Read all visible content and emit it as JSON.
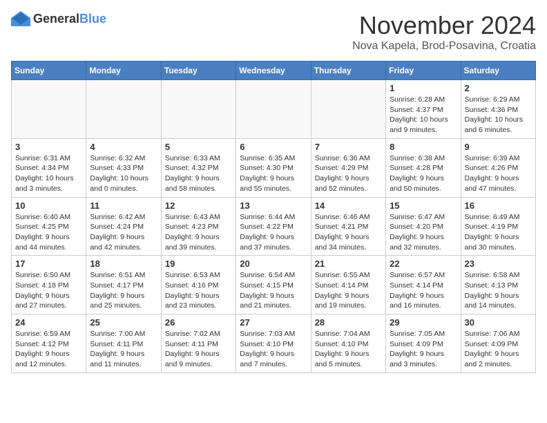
{
  "header": {
    "logo_general": "General",
    "logo_blue": "Blue",
    "month": "November 2024",
    "location": "Nova Kapela, Brod-Posavina, Croatia"
  },
  "days_of_week": [
    "Sunday",
    "Monday",
    "Tuesday",
    "Wednesday",
    "Thursday",
    "Friday",
    "Saturday"
  ],
  "weeks": [
    [
      {
        "day": "",
        "info": ""
      },
      {
        "day": "",
        "info": ""
      },
      {
        "day": "",
        "info": ""
      },
      {
        "day": "",
        "info": ""
      },
      {
        "day": "",
        "info": ""
      },
      {
        "day": "1",
        "info": "Sunrise: 6:28 AM\nSunset: 4:37 PM\nDaylight: 10 hours and 9 minutes."
      },
      {
        "day": "2",
        "info": "Sunrise: 6:29 AM\nSunset: 4:36 PM\nDaylight: 10 hours and 6 minutes."
      }
    ],
    [
      {
        "day": "3",
        "info": "Sunrise: 6:31 AM\nSunset: 4:34 PM\nDaylight: 10 hours and 3 minutes."
      },
      {
        "day": "4",
        "info": "Sunrise: 6:32 AM\nSunset: 4:33 PM\nDaylight: 10 hours and 0 minutes."
      },
      {
        "day": "5",
        "info": "Sunrise: 6:33 AM\nSunset: 4:32 PM\nDaylight: 9 hours and 58 minutes."
      },
      {
        "day": "6",
        "info": "Sunrise: 6:35 AM\nSunset: 4:30 PM\nDaylight: 9 hours and 55 minutes."
      },
      {
        "day": "7",
        "info": "Sunrise: 6:36 AM\nSunset: 4:29 PM\nDaylight: 9 hours and 52 minutes."
      },
      {
        "day": "8",
        "info": "Sunrise: 6:38 AM\nSunset: 4:28 PM\nDaylight: 9 hours and 50 minutes."
      },
      {
        "day": "9",
        "info": "Sunrise: 6:39 AM\nSunset: 4:26 PM\nDaylight: 9 hours and 47 minutes."
      }
    ],
    [
      {
        "day": "10",
        "info": "Sunrise: 6:40 AM\nSunset: 4:25 PM\nDaylight: 9 hours and 44 minutes."
      },
      {
        "day": "11",
        "info": "Sunrise: 6:42 AM\nSunset: 4:24 PM\nDaylight: 9 hours and 42 minutes."
      },
      {
        "day": "12",
        "info": "Sunrise: 6:43 AM\nSunset: 4:23 PM\nDaylight: 9 hours and 39 minutes."
      },
      {
        "day": "13",
        "info": "Sunrise: 6:44 AM\nSunset: 4:22 PM\nDaylight: 9 hours and 37 minutes."
      },
      {
        "day": "14",
        "info": "Sunrise: 6:46 AM\nSunset: 4:21 PM\nDaylight: 9 hours and 34 minutes."
      },
      {
        "day": "15",
        "info": "Sunrise: 6:47 AM\nSunset: 4:20 PM\nDaylight: 9 hours and 32 minutes."
      },
      {
        "day": "16",
        "info": "Sunrise: 6:49 AM\nSunset: 4:19 PM\nDaylight: 9 hours and 30 minutes."
      }
    ],
    [
      {
        "day": "17",
        "info": "Sunrise: 6:50 AM\nSunset: 4:18 PM\nDaylight: 9 hours and 27 minutes."
      },
      {
        "day": "18",
        "info": "Sunrise: 6:51 AM\nSunset: 4:17 PM\nDaylight: 9 hours and 25 minutes."
      },
      {
        "day": "19",
        "info": "Sunrise: 6:53 AM\nSunset: 4:16 PM\nDaylight: 9 hours and 23 minutes."
      },
      {
        "day": "20",
        "info": "Sunrise: 6:54 AM\nSunset: 4:15 PM\nDaylight: 9 hours and 21 minutes."
      },
      {
        "day": "21",
        "info": "Sunrise: 6:55 AM\nSunset: 4:14 PM\nDaylight: 9 hours and 19 minutes."
      },
      {
        "day": "22",
        "info": "Sunrise: 6:57 AM\nSunset: 4:14 PM\nDaylight: 9 hours and 16 minutes."
      },
      {
        "day": "23",
        "info": "Sunrise: 6:58 AM\nSunset: 4:13 PM\nDaylight: 9 hours and 14 minutes."
      }
    ],
    [
      {
        "day": "24",
        "info": "Sunrise: 6:59 AM\nSunset: 4:12 PM\nDaylight: 9 hours and 12 minutes."
      },
      {
        "day": "25",
        "info": "Sunrise: 7:00 AM\nSunset: 4:11 PM\nDaylight: 9 hours and 11 minutes."
      },
      {
        "day": "26",
        "info": "Sunrise: 7:02 AM\nSunset: 4:11 PM\nDaylight: 9 hours and 9 minutes."
      },
      {
        "day": "27",
        "info": "Sunrise: 7:03 AM\nSunset: 4:10 PM\nDaylight: 9 hours and 7 minutes."
      },
      {
        "day": "28",
        "info": "Sunrise: 7:04 AM\nSunset: 4:10 PM\nDaylight: 9 hours and 5 minutes."
      },
      {
        "day": "29",
        "info": "Sunrise: 7:05 AM\nSunset: 4:09 PM\nDaylight: 9 hours and 3 minutes."
      },
      {
        "day": "30",
        "info": "Sunrise: 7:06 AM\nSunset: 4:09 PM\nDaylight: 9 hours and 2 minutes."
      }
    ]
  ]
}
